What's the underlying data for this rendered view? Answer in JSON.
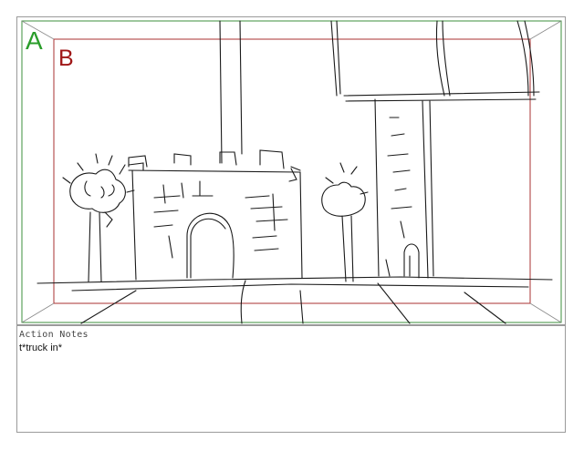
{
  "storyboard": {
    "frame_labels": {
      "a": "A",
      "b": "B"
    },
    "colors": {
      "label_a": "#2a9d2a",
      "label_b": "#a01818",
      "safe_area_a": "#3c8f3c",
      "safe_area_b": "#a83030",
      "sketch": "#1a1a1a",
      "frame_border": "#9a9a9a"
    },
    "scene": "castle-with-trees-and-tower-sketch"
  },
  "notes": {
    "header": "Action Notes",
    "text": "t*truck in*"
  }
}
